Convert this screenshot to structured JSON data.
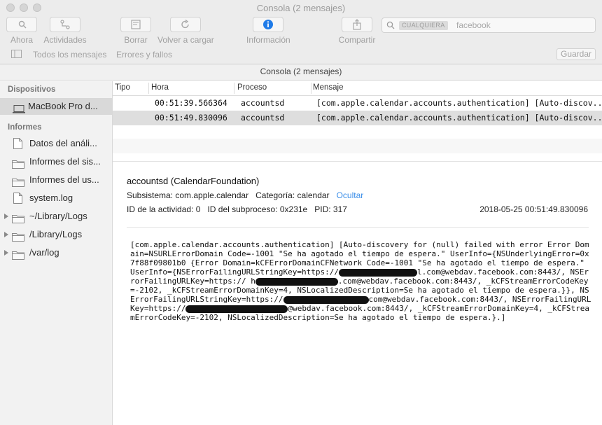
{
  "window": {
    "title": "Consola (2 mensajes)"
  },
  "toolbar": {
    "ahora": "Ahora",
    "actividades": "Actividades",
    "borrar": "Borrar",
    "volver": "Volver a cargar",
    "informacion": "Información",
    "compartir": "Compartir"
  },
  "search": {
    "scope": "CUALQUIERA",
    "query": "facebook"
  },
  "filters": {
    "todos": "Todos los mensajes",
    "errores": "Errores y fallos",
    "guardar": "Guardar"
  },
  "subtitle": "Consola (2 mensajes)",
  "sidebar": {
    "dispositivos": "Dispositivos",
    "device": "MacBook Pro d...",
    "informes": "Informes",
    "items": [
      {
        "label": "Datos del análi...",
        "icon": "document-icon"
      },
      {
        "label": "Informes del sis...",
        "icon": "folder-icon"
      },
      {
        "label": "Informes del us...",
        "icon": "folder-icon"
      },
      {
        "label": "system.log",
        "icon": "document-icon"
      },
      {
        "label": "~/Library/Logs",
        "icon": "folder-icon"
      },
      {
        "label": "/Library/Logs",
        "icon": "folder-icon"
      },
      {
        "label": "/var/log",
        "icon": "folder-icon"
      }
    ]
  },
  "table": {
    "columns": [
      "Tipo",
      "Hora",
      "Proceso",
      "Mensaje"
    ],
    "rows": [
      {
        "hora": "00:51:39.566364",
        "proceso": "accountsd",
        "mensaje": "[com.apple.calendar.accounts.authentication] [Auto-discov..."
      },
      {
        "hora": "00:51:49.830096",
        "proceso": "accountsd",
        "mensaje": "[com.apple.calendar.accounts.authentication] [Auto-discov..."
      }
    ]
  },
  "detail": {
    "title": "accountsd (CalendarFoundation)",
    "subsistema_label": "Subsistema:",
    "subsistema": "com.apple.calendar",
    "categoria_label": "Categoría:",
    "categoria": "calendar",
    "ocultar": "Ocultar",
    "actividad_label": "ID de la actividad:",
    "actividad": "0",
    "subproceso_label": "ID del subproceso:",
    "subproceso": "0x231e",
    "pid_label": "PID:",
    "pid": "317",
    "timestamp": "2018-05-25 00:51:49.830096",
    "msg_1": "[com.apple.calendar.accounts.authentication] [Auto-discovery for (null) failed with error Error Domain=NSURLErrorDomain Code=-1001 \"Se ha agotado el tiempo de espera.\" UserInfo={NSUnderlyingError=0x7f88f09801b0 {Error Domain=kCFErrorDomainCFNetwork Code=-1001 \"Se ha agotado el tiempo de espera.\" UserInfo={NSErrorFailingURLStringKey=https://",
    "msg_2": "l.com@webdav.facebook.com:8443/, NSErrorFailingURLKey=https://",
    "msg_3": "h",
    "msg_4": ".com@webdav.facebook.com:8443/, _kCFStreamErrorCodeKey=-2102, _kCFStreamErrorDomainKey=4, NSLocalizedDescription=Se ha agotado el tiempo de espera.}}, NSErrorFailingURLStringKey=https://",
    "msg_5": "com@webdav.facebook.com:8443/, NSErrorFailingURLKey=https://",
    "msg_6": "@webdav.facebook.com:8443/, _kCFStreamErrorDomainKey=4, _kCFStreamErrorCodeKey=-2102, NSLocalizedDescription=Se ha agotado el tiempo de espera.}.]"
  }
}
